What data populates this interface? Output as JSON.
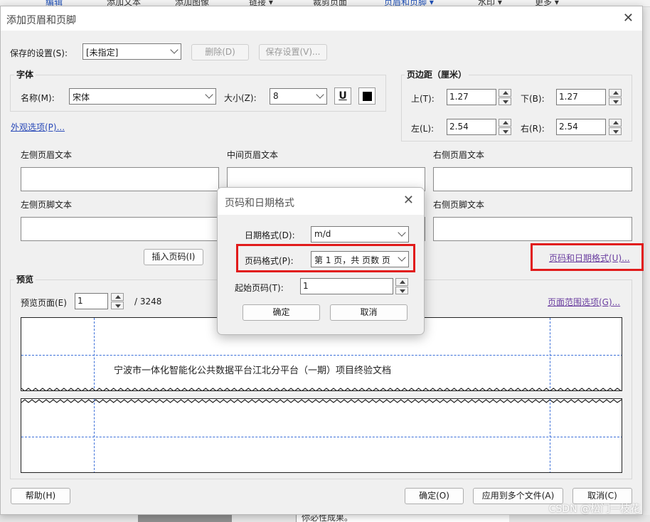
{
  "background_app": {
    "toolbar": [
      {
        "label": "编辑",
        "highlight": true
      },
      {
        "label": "添加文本",
        "highlight": false
      },
      {
        "label": "添加图像",
        "highlight": false
      },
      {
        "label": "链接 ▾",
        "highlight": false
      },
      {
        "label": "裁剪页面",
        "highlight": false
      },
      {
        "label": "页眉和页脚 ▾",
        "highlight": true
      },
      {
        "label": "水印 ▾",
        "highlight": false
      },
      {
        "label": "更多 ▾",
        "highlight": false
      }
    ],
    "document_text": "你必性成果。"
  },
  "dialog": {
    "title": "添加页眉和页脚",
    "close_glyph": "✕",
    "saved_settings": {
      "label": "保存的设置(S):",
      "value": "[未指定]",
      "delete_label": "删除(D)",
      "save_label": "保存设置(V)..."
    },
    "font": {
      "group_title": "字体",
      "name_label": "名称(M):",
      "name_value": "宋体",
      "size_label": "大小(Z):",
      "size_value": "8",
      "underline_glyph": "U",
      "color": "#000000"
    },
    "appearance_link": "外观选项(P)...",
    "margins": {
      "group_title": "页边距（厘米）",
      "top_label": "上(T):",
      "top_value": "1.27",
      "bottom_label": "下(B):",
      "bottom_value": "1.27",
      "left_label": "左(L):",
      "left_value": "2.54",
      "right_label": "右(R):",
      "right_value": "2.54"
    },
    "header_labels": {
      "left": "左侧页眉文本",
      "center": "中间页眉文本",
      "right": "右侧页眉文本"
    },
    "footer_labels": {
      "left": "左侧页脚文本",
      "right": "右侧页脚文本"
    },
    "insert_page_number": "插入页码(I)",
    "page_date_format_link": "页码和日期格式(U)...",
    "preview": {
      "group_title": "预览",
      "page_label": "预览页面(E)",
      "page_value": "1",
      "total": "/ 3248",
      "page_range_link": "页面范围选项(G)...",
      "header_text": "宁波市一体化智能化公共数据平台江北分平台（一期）项目终验文档"
    },
    "buttons": {
      "help": "帮助(H)",
      "ok": "确定(O)",
      "apply_multiple": "应用到多个文件(A)",
      "cancel": "取消(C)"
    }
  },
  "modal": {
    "title": "页码和日期格式",
    "close_glyph": "✕",
    "date_format_label": "日期格式(D):",
    "date_format_value": "m/d",
    "page_format_label": "页码格式(P):",
    "page_format_value": "第 1 页，共 页数 页",
    "start_page_label": "起始页码(T):",
    "start_page_value": "1",
    "ok": "确定",
    "cancel": "取消"
  },
  "highlight_color": "#e11b1b",
  "watermark": "CSDN @松门一枝花"
}
